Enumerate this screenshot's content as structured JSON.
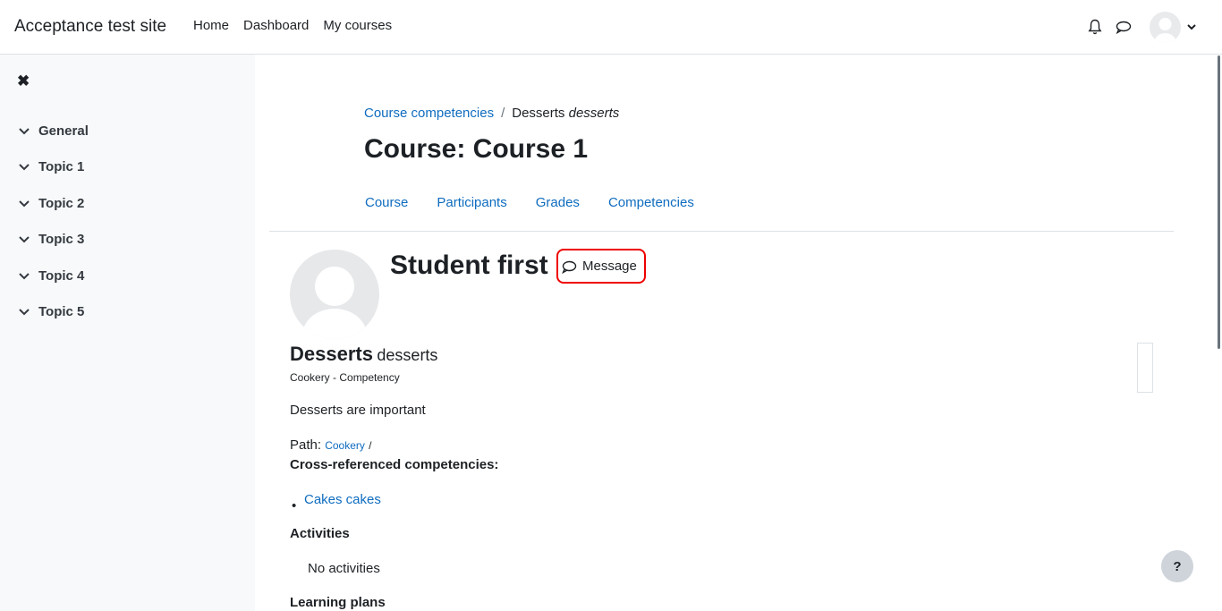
{
  "header": {
    "site_name": "Acceptance test site",
    "nav": [
      "Home",
      "Dashboard",
      "My courses"
    ]
  },
  "drawer": {
    "items": [
      "General",
      "Topic 1",
      "Topic 2",
      "Topic 3",
      "Topic 4",
      "Topic 5"
    ]
  },
  "breadcrumb": {
    "link": "Course competencies",
    "current": "Desserts",
    "current_italic": "desserts"
  },
  "page_title": "Course: Course 1",
  "tabs": [
    "Course",
    "Participants",
    "Grades",
    "Competencies"
  ],
  "user": {
    "name": "Student first",
    "message_label": "Message"
  },
  "competency": {
    "name": "Desserts",
    "idnumber": "desserts",
    "framework": "Cookery - Competency",
    "description": "Desserts are important",
    "path_label": "Path:",
    "path_link": "Cookery",
    "path_sep": "/",
    "cross_ref_heading": "Cross-referenced competencies:",
    "cross_ref_items": [
      "Cakes cakes"
    ],
    "activities_heading": "Activities",
    "activities_empty": "No activities",
    "plans_heading": "Learning plans"
  },
  "help_label": "?"
}
